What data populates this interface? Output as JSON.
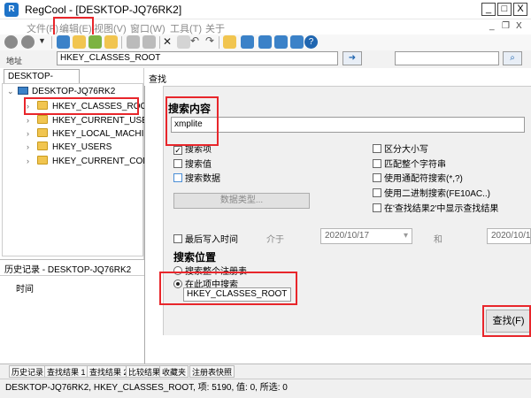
{
  "window": {
    "title": "RegCool - [DESKTOP-JQ76RK2]",
    "controls": {
      "minimize": "_",
      "maximize": "□",
      "close": "X"
    },
    "inner_controls": {
      "minimize": "_",
      "restore": "❐",
      "close": "X"
    }
  },
  "menu": {
    "items": [
      "文件(F)",
      "编辑(E)",
      "视图(V)",
      "窗口(W)",
      "工具(T)",
      "关于"
    ]
  },
  "address": {
    "label": "地址",
    "value": "HKEY_CLASSES_ROOT"
  },
  "left": {
    "tab": "DESKTOP-JQ76RK2",
    "tree": {
      "root": "DESKTOP-JQ76RK2",
      "items": [
        "HKEY_CLASSES_ROOT",
        "HKEY_CURRENT_USER",
        "HKEY_LOCAL_MACHINE",
        "HKEY_USERS",
        "HKEY_CURRENT_CONFIG"
      ]
    },
    "history_title": "历史记录 - DESKTOP-JQ76RK2",
    "history_column": "时间"
  },
  "dialog": {
    "title": "查找",
    "search_content_label": "搜索内容",
    "search_value": "xmplite",
    "options_left": {
      "search_keys": "搜索项",
      "search_values": "搜索值",
      "search_data": "搜索数据",
      "data_type_button": "数据类型..."
    },
    "options_right": {
      "match_case": "区分大小写",
      "match_whole": "匹配整个字符串",
      "wildcard": "使用通配符搜索(*,?)",
      "binary": "使用二进制搜索(FE10AC..)",
      "show_in_results": "在'查找结果2'中显示查找结果"
    },
    "last_write": {
      "label": "最后写入时间",
      "between": "介于",
      "and": "和",
      "date_from": "2020/10/17",
      "date_to": "2020/10/1"
    },
    "location": {
      "label": "搜索位置",
      "whole_registry": "搜索整个注册表",
      "in_this_key": "在此项中搜索",
      "key_value": "HKEY_CLASSES_ROOT"
    },
    "find_button": "查找(F)"
  },
  "bottom_tabs": [
    "历史记录",
    "查找结果 1",
    "查找结果 2",
    "比较结果",
    "收藏夹",
    "注册表快照"
  ],
  "status": "DESKTOP-JQ76RK2, HKEY_CLASSES_ROOT, 项: 5190, 值: 0, 所选: 0",
  "colors": {
    "highlight": "#e8262b",
    "folder": "#f1c550",
    "accent": "#1e73c8"
  }
}
